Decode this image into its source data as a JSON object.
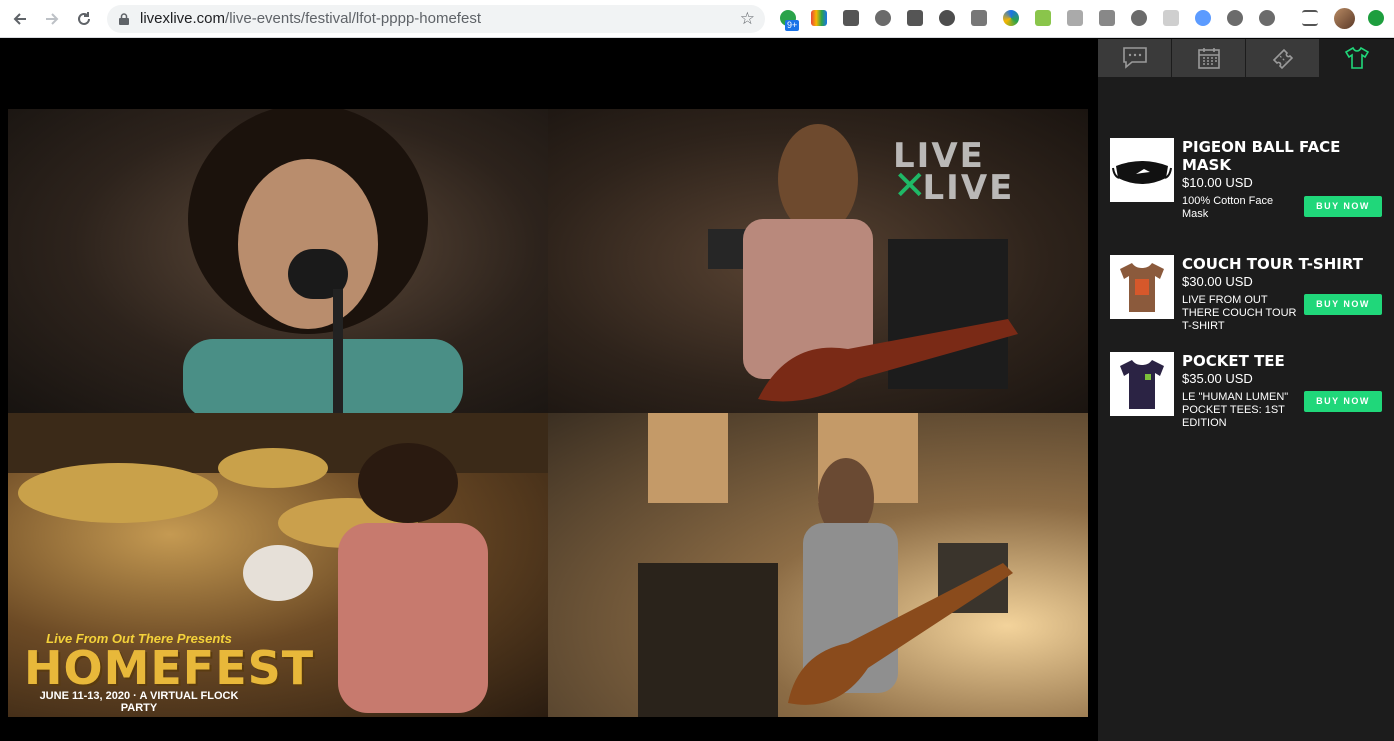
{
  "browser": {
    "url_host": "livexlive.com",
    "url_path": "/live-events/festival/lfot-pppp-homefest",
    "extension_badge": "9+"
  },
  "stage": {
    "close_label": "✕",
    "watermark_top": "LIVE",
    "watermark_bottom": "LIVE",
    "overlay": {
      "presents": "Live From Out There Presents",
      "title": "HOMEFEST",
      "subtitle": "JUNE 11-13, 2020 · A VIRTUAL FLOCK PARTY"
    }
  },
  "panel": {
    "tabs": [
      {
        "name": "chat",
        "icon": "chat-icon",
        "active": false
      },
      {
        "name": "schedule",
        "icon": "calendar-icon",
        "active": false
      },
      {
        "name": "tickets",
        "icon": "ticket-icon",
        "active": false
      },
      {
        "name": "merch",
        "icon": "tshirt-icon",
        "active": true
      }
    ],
    "accent": "#20d77a",
    "items": [
      {
        "title": "PIGEON BALL FACE MASK",
        "price": "$10.00 USD",
        "desc": "100% Cotton Face Mask",
        "button": "BUY NOW"
      },
      {
        "title": "COUCH TOUR T-SHIRT",
        "price": "$30.00 USD",
        "desc": "LIVE FROM OUT THERE COUCH TOUR T-SHIRT",
        "button": "BUY NOW"
      },
      {
        "title": "POCKET TEE",
        "price": "$35.00 USD",
        "desc": "LE \"HUMAN LUMEN\" POCKET TEES: 1ST EDITION",
        "button": "BUY NOW"
      }
    ]
  }
}
